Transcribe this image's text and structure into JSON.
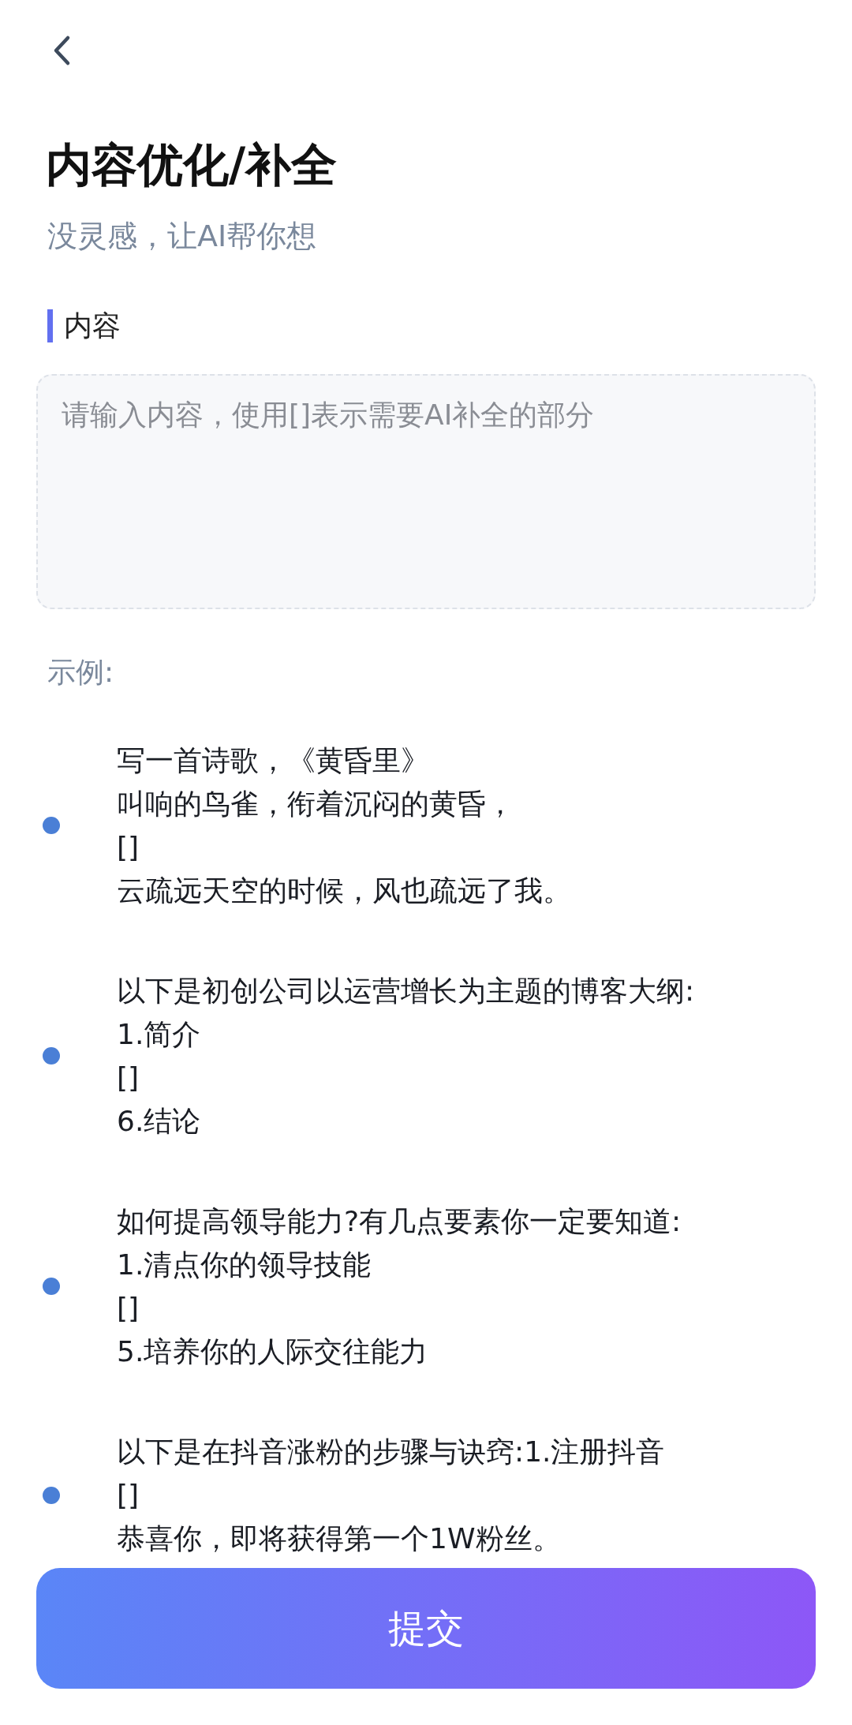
{
  "header": {
    "title": "内容优化/补全",
    "subtitle": "没灵感，让AI帮你想"
  },
  "section": {
    "label": "内容"
  },
  "content_field": {
    "placeholder": "请输入内容，使用[]表示需要AI补全的部分"
  },
  "examples": {
    "label": "示例:",
    "items": [
      {
        "lines": [
          "写一首诗歌，《黄昏里》",
          "叫响的鸟雀，衔着沉闷的黄昏，",
          "[]",
          "云疏远天空的时候，风也疏远了我。"
        ]
      },
      {
        "lines": [
          "以下是初创公司以运营增长为主题的博客大纲:",
          "1.简介",
          "[]",
          "6.结论"
        ]
      },
      {
        "lines": [
          "如何提高领导能力?有几点要素你一定要知道:",
          "1.清点你的领导技能",
          "[]",
          "5.培养你的人际交往能力"
        ]
      },
      {
        "lines": [
          "以下是在抖音涨粉的步骤与诀窍:1.注册抖音",
          "[]",
          "恭喜你，即将获得第一个1W粉丝。"
        ]
      }
    ]
  },
  "submit_button": {
    "label": "提交"
  }
}
